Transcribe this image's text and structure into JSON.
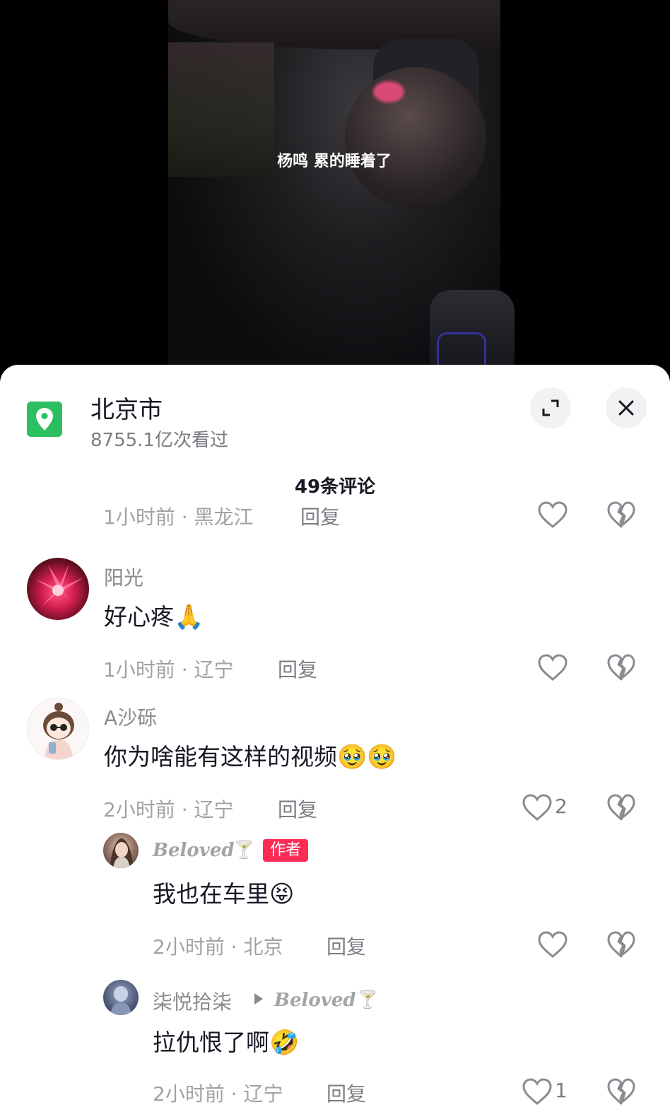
{
  "video": {
    "caption": "杨鸣 累的睡着了"
  },
  "location": {
    "title": "北京市",
    "views": "8755.1亿次看过"
  },
  "comments_header": "49条评论",
  "partial_comment": {
    "time": "1小时前 · 黑龙江",
    "reply_label": "回复"
  },
  "comments": [
    {
      "username": "阳光",
      "text": "好心疼",
      "emoji": "🙏",
      "time": "1小时前 · 辽宁",
      "reply_label": "回复",
      "likes": ""
    },
    {
      "username": "A沙砾",
      "text": "你为啥能有这样的视频",
      "emoji": "🥹🥹",
      "time": "2小时前 · 辽宁",
      "reply_label": "回复",
      "likes": "2"
    }
  ],
  "replies": [
    {
      "username": "Beloved",
      "username_icon": "🍸",
      "badge": "作者",
      "text": "我也在车里",
      "emoji": "😝",
      "time": "2小时前 · 北京",
      "reply_label": "回复",
      "likes": ""
    },
    {
      "username": "柒悦拾柒",
      "reply_to": "Beloved",
      "reply_to_icon": "🍸",
      "text": "拉仇恨了啊",
      "emoji": "🤣",
      "time": "2小时前 · 辽宁",
      "reply_label": "回复",
      "likes": "1"
    }
  ],
  "colors": {
    "accent_green": "#2bbf62",
    "badge_red": "#fe2c55"
  }
}
